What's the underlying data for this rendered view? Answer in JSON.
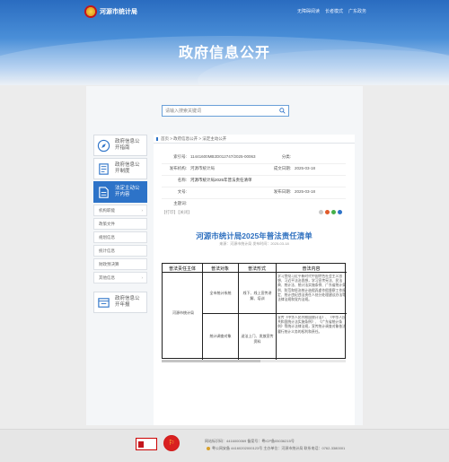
{
  "header": {
    "site_name": "河源市统计局",
    "top_links": [
      "无障碍阅读",
      "长者模式",
      "广东政务"
    ],
    "banner_title": "政府信息公开"
  },
  "search": {
    "placeholder": "请输入搜索关键词"
  },
  "sidebar": {
    "items": [
      {
        "label": "政府信息公开指南"
      },
      {
        "label": "政府信息公开制度"
      },
      {
        "label": "法定主动公开内容"
      }
    ],
    "sub_items": [
      {
        "label": "机构职能"
      },
      {
        "label": "政策文件"
      },
      {
        "label": "规划信息"
      },
      {
        "label": "统计信息"
      },
      {
        "label": "财政预决算"
      },
      {
        "label": "其他信息"
      }
    ],
    "annual": {
      "label": "政府信息公开年报"
    }
  },
  "content": {
    "breadcrumb": "首页 > 政府信息公开 > 法定主动公开",
    "meta": [
      {
        "key": "索引号:",
        "value": "11441600MB2D012747/2025-00063"
      },
      {
        "key": "分类:",
        "value": ""
      },
      {
        "key": "发布机构:",
        "value": "河源市统计局"
      },
      {
        "key": "成文日期:",
        "value": "2025-03-18"
      },
      {
        "key": "名称:",
        "value": "河源市统计局2025年普法责任清单"
      },
      {
        "key": "文号:",
        "value": ""
      },
      {
        "key": "发布日期:",
        "value": "2025-03-18"
      },
      {
        "key": "主题词:",
        "value": ""
      }
    ],
    "tools_left": "【打印】【关闭】",
    "doc_title": "河源市统计局2025年普法责任清单",
    "doc_sub": "来源：河源市统计局  发布时间：2025-03-18",
    "table": {
      "headers": [
        "普法责任主体",
        "普法对象",
        "普法形式",
        "普法内容"
      ],
      "rows": [
        {
          "subject": "河源市统计局",
          "audience": "全市统计系统",
          "form": "线下、线上宣传讲解、培训",
          "content": "学习贯彻习近平新时代中国特色社会主义思想、习近平法治思想，学习宣传宪法、民法典、统计法、统计法实施条例、广东省统计条例、防范和惩治统计造假弄虚作假督察工作规定、统计违纪违法责任人处分处理建议办法等法律法规和党内法规。"
        },
        {
          "subject": "",
          "audience": "统计调查对象",
          "form": "送法上门、发放宣传资料",
          "content": "宣传《中华人民共和国统计法》、《中华人民共和国统计法实施条例》、《广东省统计条例》等统计法律法规，宣传统计调查对象依法履行统计义务的权利和责任。"
        }
      ]
    }
  },
  "footer": {
    "line1": "网站标识码：4416000069 备案号：粤ICP备05036215号",
    "line2": "粤公网安备 44160202000123号 主办单位：河源市统计局 联系电话：0762-3380001"
  },
  "colors": {
    "primary": "#2d73c8",
    "title_blue": "#2d6fbf"
  }
}
